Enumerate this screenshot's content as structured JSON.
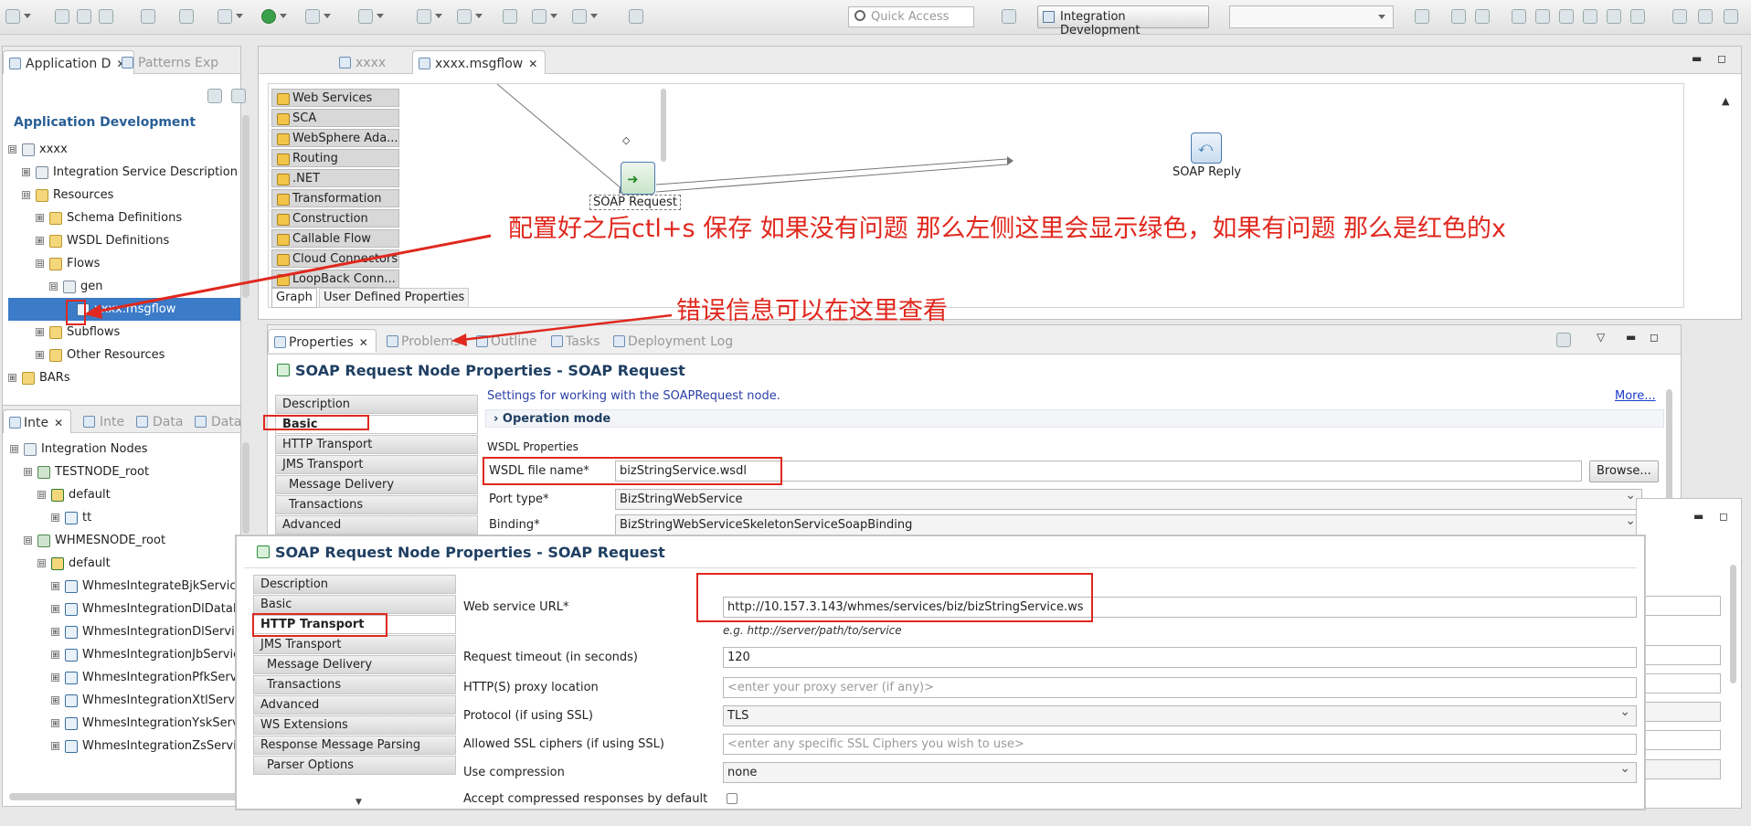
{
  "toolbar": {
    "quick_access_placeholder": "Quick Access",
    "perspective_label": "Integration Development"
  },
  "left_top": {
    "tabs": [
      {
        "label": "Application D"
      },
      {
        "label": "Patterns Exp"
      }
    ],
    "title": "Application Development",
    "tree": [
      {
        "label": "xxxx",
        "exp": "⊟",
        "icon": "app-icon"
      },
      {
        "label": "Integration Service Description",
        "exp": "⊞",
        "icon": "descriptor-icon"
      },
      {
        "label": "Resources",
        "exp": "⊟",
        "icon": "folder-icon"
      },
      {
        "label": "Schema Definitions",
        "exp": "⊞",
        "icon": "folder-icon"
      },
      {
        "label": "WSDL Definitions",
        "exp": "⊞",
        "icon": "folder-icon"
      },
      {
        "label": "Flows",
        "exp": "⊟",
        "icon": "folder-icon"
      },
      {
        "label": "gen",
        "exp": "⊟",
        "icon": "package-icon"
      },
      {
        "label": "xxxx.msgflow",
        "exp": "",
        "icon": "msgflow-icon"
      },
      {
        "label": "Subflows",
        "exp": "⊞",
        "icon": "folder-icon"
      },
      {
        "label": "Other Resources",
        "exp": "⊞",
        "icon": "folder-icon"
      },
      {
        "label": "BARs",
        "exp": "⊞",
        "icon": "folder-icon"
      }
    ]
  },
  "left_bottom": {
    "tabs": [
      {
        "label": "Inte"
      },
      {
        "label": "Inte"
      },
      {
        "label": "Data"
      },
      {
        "label": "Data"
      }
    ],
    "tree": [
      {
        "label": "Integration Nodes",
        "exp": "⊟"
      },
      {
        "label": "TESTNODE_root",
        "exp": "⊟"
      },
      {
        "label": "default",
        "exp": "⊟"
      },
      {
        "label": "tt",
        "exp": "⊞"
      },
      {
        "label": "WHMESNODE_root",
        "exp": "⊟"
      },
      {
        "label": "default",
        "exp": "⊟"
      },
      {
        "label": "WhmesIntegrateBjkService",
        "exp": "⊞"
      },
      {
        "label": "WhmesIntegrationDlDataF",
        "exp": "⊞"
      },
      {
        "label": "WhmesIntegrationDlServic",
        "exp": "⊞"
      },
      {
        "label": "WhmesIntegrationJbServic",
        "exp": "⊞"
      },
      {
        "label": "WhmesIntegrationPfkServ",
        "exp": "⊞"
      },
      {
        "label": "WhmesIntegrationXtlServi",
        "exp": "⊞"
      },
      {
        "label": "WhmesIntegrationYskServ",
        "exp": "⊞"
      },
      {
        "label": "WhmesIntegrationZsServi",
        "exp": "⊞"
      }
    ]
  },
  "editor": {
    "tabs": [
      {
        "label": "xxxx"
      },
      {
        "label": "xxxx.msgflow"
      }
    ],
    "palette": [
      "Web Services",
      "SCA",
      "WebSphere Ada...",
      "Routing",
      ".NET",
      "Transformation",
      "Construction",
      "Callable Flow",
      "Cloud Connectors",
      "LoopBack Conn..."
    ],
    "palette_collapse": "◇",
    "nodes": {
      "request": "SOAP Request",
      "reply": "SOAP Reply"
    },
    "bottom_tabs": [
      "Graph",
      "User Defined Properties"
    ]
  },
  "annotations": {
    "note1": "配置好之后ctl+s 保存 如果没有问题 那么左侧这里会显示绿色，如果有问题 那么是红色的x",
    "note2": "错误信息可以在这里查看"
  },
  "props_panel": {
    "tabs": [
      "Properties",
      "Problems",
      "Outline",
      "Tasks",
      "Deployment Log"
    ],
    "title": "SOAP Request Node Properties - SOAP Request",
    "sections": [
      "Description",
      "Basic",
      "HTTP Transport",
      "JMS Transport",
      "Message Delivery",
      "Transactions",
      "Advanced"
    ],
    "intro": "Settings for working with the SOAPRequest node.",
    "more_link": "More...",
    "operation_mode": "Operation mode",
    "wsdl_group": "WSDL Properties",
    "wsdl_label": "WSDL file name*",
    "wsdl_value": "bizStringService.wsdl",
    "browse": "Browse...",
    "port_label": "Port type*",
    "port_value": "BizStringWebService",
    "binding_label": "Binding*",
    "binding_value": "BizStringWebServiceSkeletonServiceSoapBinding"
  },
  "overlay": {
    "title": "SOAP Request Node Properties - SOAP Request",
    "sections": [
      "Description",
      "Basic",
      "HTTP Transport",
      "JMS Transport",
      "Message Delivery",
      "Transactions",
      "Advanced",
      "WS Extensions",
      "Response Message Parsing",
      "Parser Options"
    ],
    "fields": {
      "url_label": "Web service URL*",
      "url_value": "http://10.157.3.143/whmes/services/biz/bizStringService.ws",
      "url_hint": "e.g. http://server/path/to/service",
      "timeout_label": "Request timeout (in seconds)",
      "timeout_value": "120",
      "proxy_label": "HTTP(S) proxy location",
      "proxy_placeholder": "<enter your proxy server (if any)>",
      "protocol_label": "Protocol (if using SSL)",
      "protocol_value": "TLS",
      "ciphers_label": "Allowed SSL ciphers (if using SSL)",
      "ciphers_placeholder": "<enter any specific SSL Ciphers you wish to use>",
      "compression_label": "Use compression",
      "compression_value": "none",
      "accept_label": "Accept compressed responses by default"
    }
  }
}
